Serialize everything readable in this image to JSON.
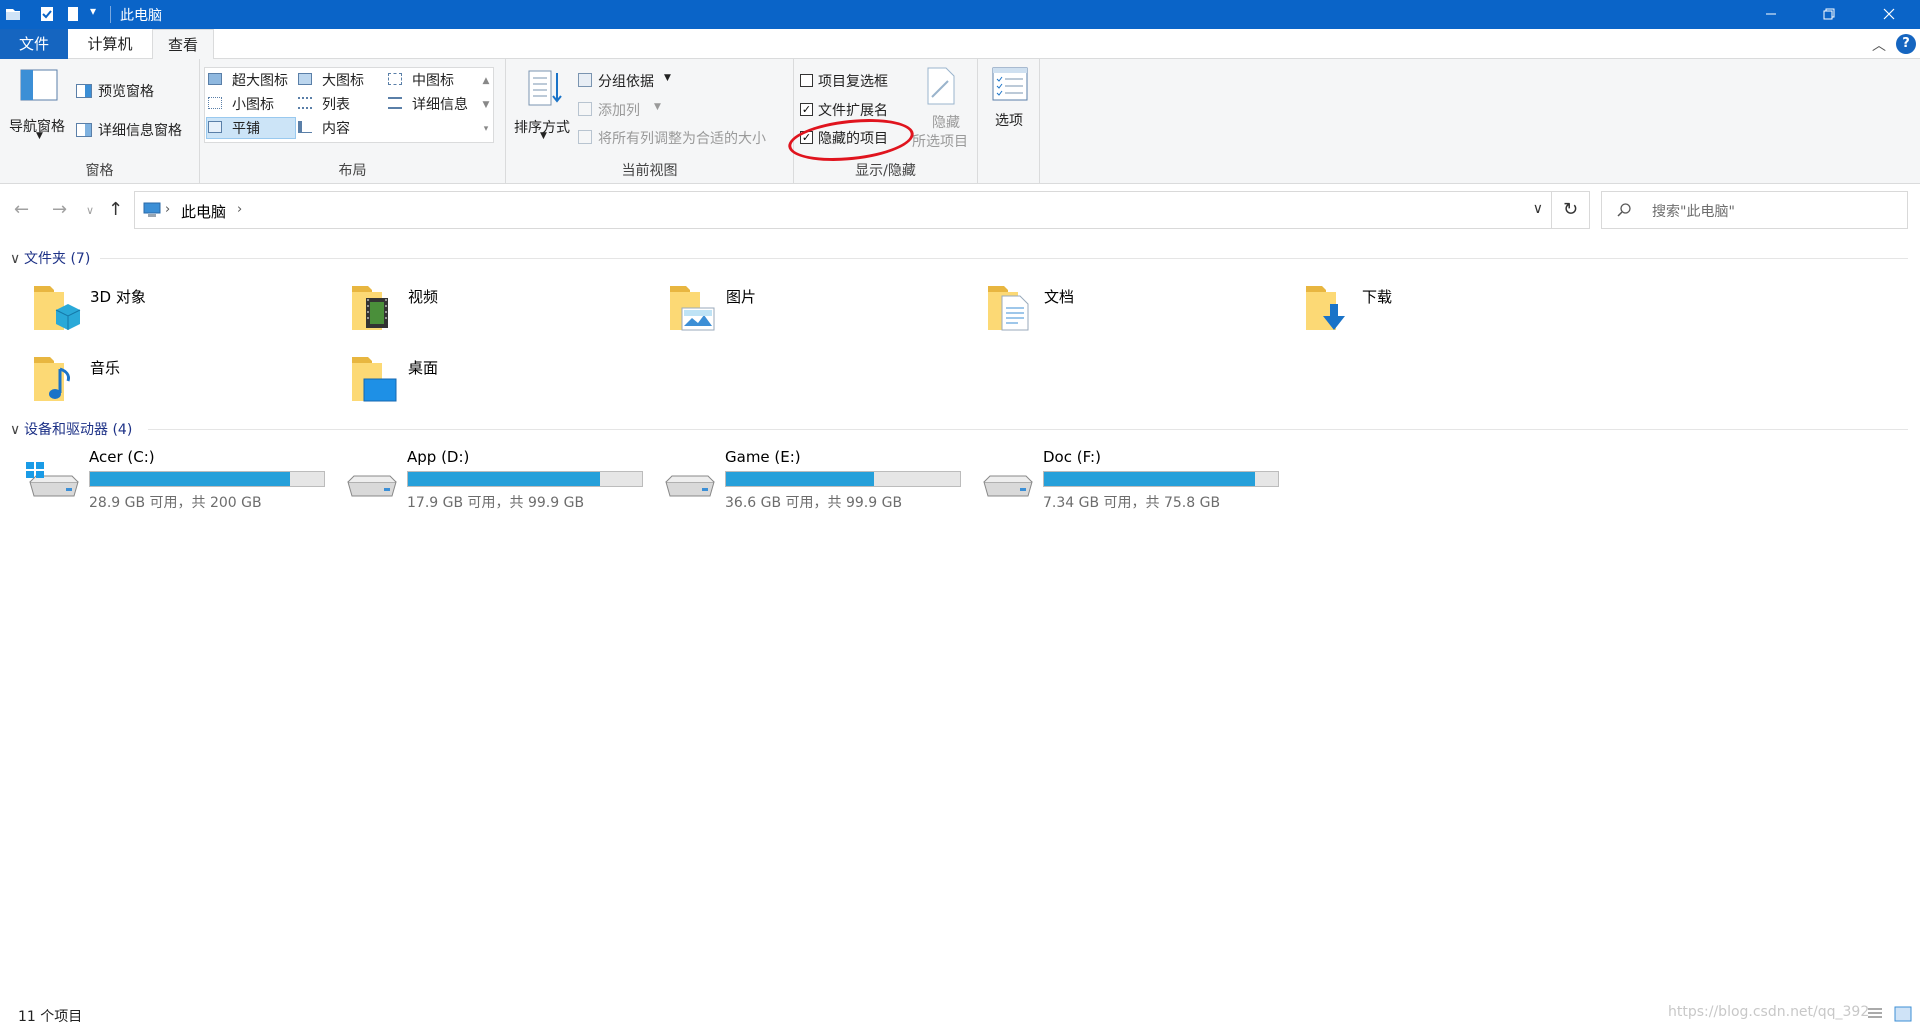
{
  "window": {
    "title": "此电脑",
    "controls": [
      "minimize-icon",
      "restore-icon",
      "close-icon"
    ]
  },
  "tabs": [
    "文件",
    "计算机",
    "查看"
  ],
  "ribbon": {
    "panes": {
      "nav_pane": "导航窗格",
      "preview_pane": "预览窗格",
      "details_pane": "详细信息窗格",
      "group_label": "窗格"
    },
    "layout": {
      "items": [
        "超大图标",
        "大图标",
        "中图标",
        "小图标",
        "列表",
        "详细信息",
        "平铺",
        "内容"
      ],
      "selected": "平铺",
      "group_label": "布局"
    },
    "current_view": {
      "sort_by": "排序方式",
      "group_by": "分组依据",
      "add_columns": "添加列",
      "size_columns": "将所有列调整为合适的大小",
      "group_label": "当前视图"
    },
    "show_hide": {
      "item_checkboxes": "项目复选框",
      "item_checkboxes_checked": false,
      "file_extensions": "文件扩展名",
      "file_extensions_checked": true,
      "hidden_items": "隐藏的项目",
      "hidden_items_checked": true,
      "hide_selected_1": "隐藏",
      "hide_selected_2": "所选项目",
      "group_label": "显示/隐藏"
    },
    "options": "选项",
    "accent": "#e0141e"
  },
  "address": {
    "path": "此电脑",
    "search_placeholder": "搜索\"此电脑\""
  },
  "folders_section": {
    "header": "文件夹 (7)",
    "items": [
      {
        "name": "3D 对象",
        "icon": "3d-objects-folder-icon"
      },
      {
        "name": "视频",
        "icon": "videos-folder-icon"
      },
      {
        "name": "图片",
        "icon": "pictures-folder-icon"
      },
      {
        "name": "文档",
        "icon": "documents-folder-icon"
      },
      {
        "name": "下载",
        "icon": "downloads-folder-icon"
      },
      {
        "name": "音乐",
        "icon": "music-folder-icon"
      },
      {
        "name": "桌面",
        "icon": "desktop-folder-icon"
      }
    ]
  },
  "drives_section": {
    "header": "设备和驱动器 (4)",
    "items": [
      {
        "name": "Acer (C:)",
        "info": "28.9 GB 可用，共 200 GB",
        "used_fraction": 0.8555,
        "icon": "windows-drive-icon"
      },
      {
        "name": "App (D:)",
        "info": "17.9 GB 可用，共 99.9 GB",
        "used_fraction": 0.8208,
        "icon": "drive-icon"
      },
      {
        "name": "Game (E:)",
        "info": "36.6 GB 可用，共 99.9 GB",
        "used_fraction": 0.6336,
        "icon": "drive-icon"
      },
      {
        "name": "Doc (F:)",
        "info": "7.34 GB 可用，共 75.8 GB",
        "used_fraction": 0.9032,
        "icon": "drive-icon"
      }
    ]
  },
  "status": {
    "count": "11 个项目",
    "watermark": "https://blog.csdn.net/qq_392"
  }
}
